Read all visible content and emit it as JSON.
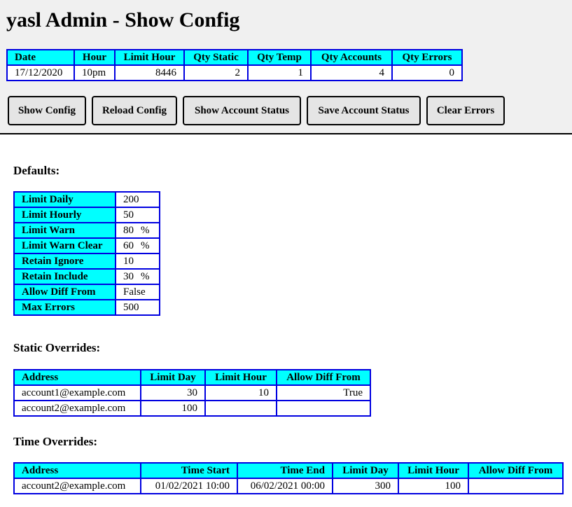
{
  "header": {
    "title": "yasl Admin - Show Config",
    "status_table": {
      "columns": [
        "Date",
        "Hour",
        "Limit Hour",
        "Qty Static",
        "Qty Temp",
        "Qty Accounts",
        "Qty Errors"
      ],
      "row": [
        "17/12/2020",
        "10pm",
        "8446",
        "2",
        "1",
        "4",
        "0"
      ]
    },
    "buttons": {
      "show_config": "Show Config",
      "reload_config": "Reload Config",
      "show_account_status": "Show Account Status",
      "save_account_status": "Save Account Status",
      "clear_errors": "Clear Errors"
    }
  },
  "defaults": {
    "heading": "Defaults:",
    "rows": [
      {
        "label": "Limit Daily",
        "value": "200",
        "unit": ""
      },
      {
        "label": "Limit Hourly",
        "value": "50",
        "unit": ""
      },
      {
        "label": "Limit Warn",
        "value": "80",
        "unit": "%"
      },
      {
        "label": "Limit Warn Clear",
        "value": "60",
        "unit": "%"
      },
      {
        "label": "Retain Ignore",
        "value": "10",
        "unit": ""
      },
      {
        "label": "Retain Include",
        "value": "30",
        "unit": "%"
      },
      {
        "label": "Allow Diff From",
        "value": "False",
        "unit": ""
      },
      {
        "label": "Max Errors",
        "value": "500",
        "unit": ""
      }
    ]
  },
  "static_overrides": {
    "heading": "Static Overrides:",
    "columns": [
      "Address",
      "Limit Day",
      "Limit Hour",
      "Allow Diff From"
    ],
    "rows": [
      [
        "account1@example.com",
        "30",
        "10",
        "True"
      ],
      [
        "account2@example.com",
        "100",
        "",
        ""
      ]
    ]
  },
  "time_overrides": {
    "heading": "Time Overrides:",
    "columns": [
      "Address",
      "Time Start",
      "Time End",
      "Limit Day",
      "Limit Hour",
      "Allow Diff From"
    ],
    "rows": [
      [
        "account2@example.com",
        "01/02/2021 10:00",
        "06/02/2021 00:00",
        "300",
        "100",
        ""
      ]
    ]
  },
  "colors": {
    "header_bg": "#f0f0f0",
    "table_header_bg": "#00ffff",
    "table_border": "#0000e0",
    "button_bg": "#e5e5e5"
  }
}
